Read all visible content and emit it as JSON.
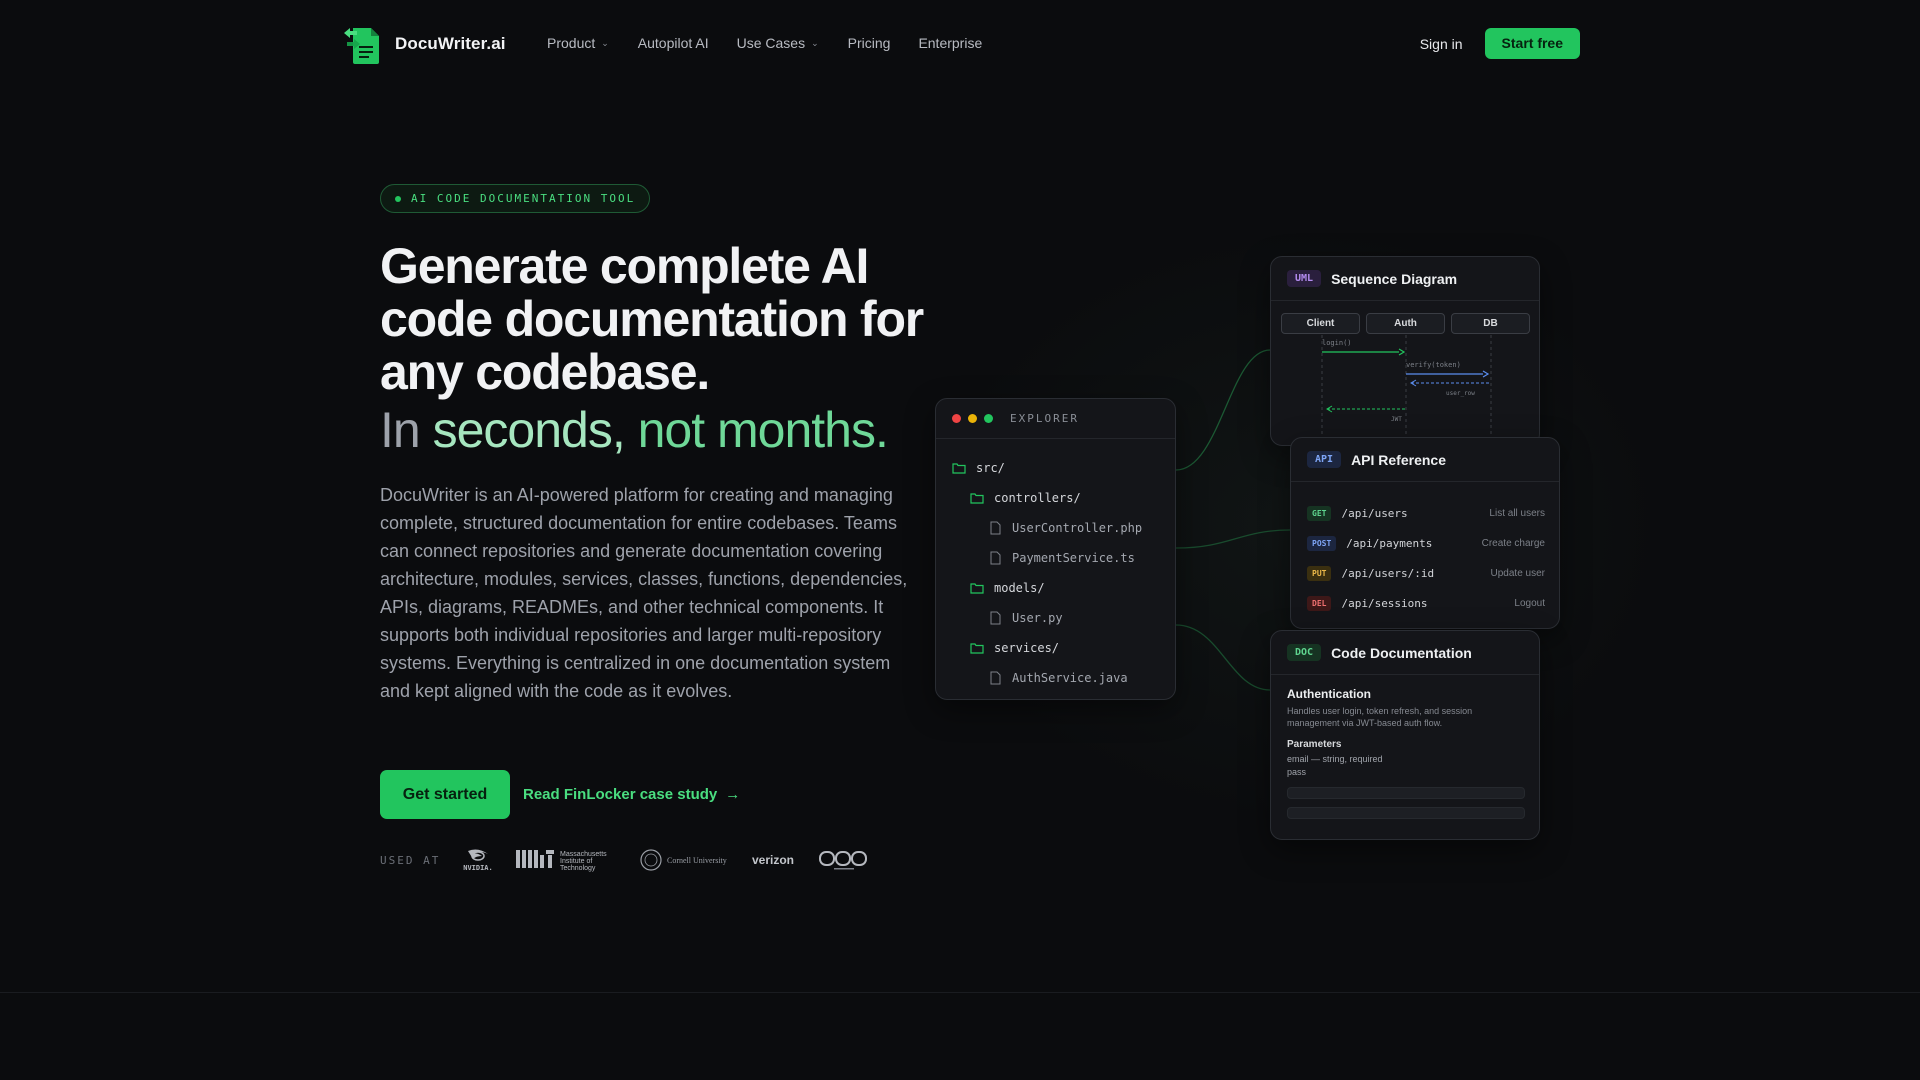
{
  "nav": {
    "logo_text": "DocuWriter.ai",
    "links": [
      {
        "label": "Product",
        "has_dropdown": true
      },
      {
        "label": "Autopilot AI",
        "has_dropdown": false
      },
      {
        "label": "Use Cases",
        "has_dropdown": true
      },
      {
        "label": "Pricing",
        "has_dropdown": false
      },
      {
        "label": "Enterprise",
        "has_dropdown": false
      }
    ],
    "signin": "Sign in",
    "start_free": "Start free"
  },
  "hero": {
    "badge": "AI CODE DOCUMENTATION TOOL",
    "headline": "Generate complete AI code documentation for any codebase.",
    "sub_a": "In ",
    "sub_b": "seconds, ",
    "sub_c": "not months.",
    "description": "DocuWriter is an AI-powered platform for creating and managing complete, structured documentation for entire codebases. Teams can connect repositories and generate documentation covering architecture, modules, services, classes, functions, dependencies, APIs, diagrams, READMEs, and other technical components. It supports both individual repositories and larger multi-repository systems. Everything is centralized in one documentation system and kept aligned with the code as it evolves.",
    "cta_primary": "Get started",
    "cta_secondary": "Read FinLocker case study",
    "cta_arrow": "→",
    "used_at": "USED AT",
    "logos": [
      "nvidia",
      "mit",
      "cornell",
      "verizon",
      "unknown"
    ],
    "logo_text": {
      "nvidia": "NVIDIA.",
      "mit_1": "Massachusetts",
      "mit_2": "Institute of",
      "mit_3": "Technology",
      "cornell": "Cornell University",
      "verizon": "verizon"
    }
  },
  "explorer": {
    "title": "EXPLORER",
    "tree": [
      {
        "name": "src/",
        "type": "folder",
        "depth": 0
      },
      {
        "name": "controllers/",
        "type": "folder",
        "depth": 1
      },
      {
        "name": "UserController.php",
        "type": "file",
        "depth": 2
      },
      {
        "name": "PaymentService.ts",
        "type": "file",
        "depth": 2
      },
      {
        "name": "models/",
        "type": "folder",
        "depth": 1
      },
      {
        "name": "User.py",
        "type": "file",
        "depth": 2
      },
      {
        "name": "services/",
        "type": "folder",
        "depth": 1
      },
      {
        "name": "AuthService.java",
        "type": "file",
        "depth": 2
      }
    ]
  },
  "sequence": {
    "tag": "UML",
    "title": "Sequence Diagram",
    "actors": [
      "Client",
      "Auth",
      "DB"
    ],
    "messages": [
      "login()",
      "verify(token)",
      "user_row",
      "JWT"
    ]
  },
  "api_reference": {
    "tag": "API",
    "title": "API Reference",
    "rows": [
      {
        "method": "GET",
        "path": "/api/users",
        "desc": "List all users"
      },
      {
        "method": "POST",
        "path": "/api/payments",
        "desc": "Create charge"
      },
      {
        "method": "PUT",
        "path": "/api/users/:id",
        "desc": "Update user"
      },
      {
        "method": "DEL",
        "path": "/api/sessions",
        "desc": "Logout"
      }
    ]
  },
  "code_doc": {
    "tag": "DOC",
    "title": "Code Documentation",
    "heading": "Authentication",
    "body": "Handles user login, token refresh, and session management via JWT-based auth flow.",
    "params_label": "Parameters",
    "params": [
      "email — string, required",
      "pass"
    ]
  },
  "colors": {
    "accent": "#22c55e",
    "background": "#0b0c0e",
    "card": "#141519"
  }
}
